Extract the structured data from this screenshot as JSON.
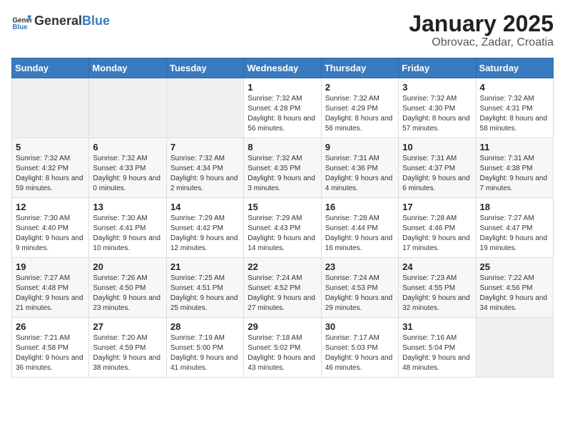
{
  "header": {
    "logo_general": "General",
    "logo_blue": "Blue",
    "title": "January 2025",
    "subtitle": "Obrovac, Zadar, Croatia"
  },
  "calendar": {
    "days_of_week": [
      "Sunday",
      "Monday",
      "Tuesday",
      "Wednesday",
      "Thursday",
      "Friday",
      "Saturday"
    ],
    "weeks": [
      [
        {
          "day": "",
          "info": ""
        },
        {
          "day": "",
          "info": ""
        },
        {
          "day": "",
          "info": ""
        },
        {
          "day": "1",
          "info": "Sunrise: 7:32 AM\nSunset: 4:28 PM\nDaylight: 8 hours and 56 minutes."
        },
        {
          "day": "2",
          "info": "Sunrise: 7:32 AM\nSunset: 4:29 PM\nDaylight: 8 hours and 56 minutes."
        },
        {
          "day": "3",
          "info": "Sunrise: 7:32 AM\nSunset: 4:30 PM\nDaylight: 8 hours and 57 minutes."
        },
        {
          "day": "4",
          "info": "Sunrise: 7:32 AM\nSunset: 4:31 PM\nDaylight: 8 hours and 58 minutes."
        }
      ],
      [
        {
          "day": "5",
          "info": "Sunrise: 7:32 AM\nSunset: 4:32 PM\nDaylight: 8 hours and 59 minutes."
        },
        {
          "day": "6",
          "info": "Sunrise: 7:32 AM\nSunset: 4:33 PM\nDaylight: 9 hours and 0 minutes."
        },
        {
          "day": "7",
          "info": "Sunrise: 7:32 AM\nSunset: 4:34 PM\nDaylight: 9 hours and 2 minutes."
        },
        {
          "day": "8",
          "info": "Sunrise: 7:32 AM\nSunset: 4:35 PM\nDaylight: 9 hours and 3 minutes."
        },
        {
          "day": "9",
          "info": "Sunrise: 7:31 AM\nSunset: 4:36 PM\nDaylight: 9 hours and 4 minutes."
        },
        {
          "day": "10",
          "info": "Sunrise: 7:31 AM\nSunset: 4:37 PM\nDaylight: 9 hours and 6 minutes."
        },
        {
          "day": "11",
          "info": "Sunrise: 7:31 AM\nSunset: 4:38 PM\nDaylight: 9 hours and 7 minutes."
        }
      ],
      [
        {
          "day": "12",
          "info": "Sunrise: 7:30 AM\nSunset: 4:40 PM\nDaylight: 9 hours and 9 minutes."
        },
        {
          "day": "13",
          "info": "Sunrise: 7:30 AM\nSunset: 4:41 PM\nDaylight: 9 hours and 10 minutes."
        },
        {
          "day": "14",
          "info": "Sunrise: 7:29 AM\nSunset: 4:42 PM\nDaylight: 9 hours and 12 minutes."
        },
        {
          "day": "15",
          "info": "Sunrise: 7:29 AM\nSunset: 4:43 PM\nDaylight: 9 hours and 14 minutes."
        },
        {
          "day": "16",
          "info": "Sunrise: 7:28 AM\nSunset: 4:44 PM\nDaylight: 9 hours and 16 minutes."
        },
        {
          "day": "17",
          "info": "Sunrise: 7:28 AM\nSunset: 4:46 PM\nDaylight: 9 hours and 17 minutes."
        },
        {
          "day": "18",
          "info": "Sunrise: 7:27 AM\nSunset: 4:47 PM\nDaylight: 9 hours and 19 minutes."
        }
      ],
      [
        {
          "day": "19",
          "info": "Sunrise: 7:27 AM\nSunset: 4:48 PM\nDaylight: 9 hours and 21 minutes."
        },
        {
          "day": "20",
          "info": "Sunrise: 7:26 AM\nSunset: 4:50 PM\nDaylight: 9 hours and 23 minutes."
        },
        {
          "day": "21",
          "info": "Sunrise: 7:25 AM\nSunset: 4:51 PM\nDaylight: 9 hours and 25 minutes."
        },
        {
          "day": "22",
          "info": "Sunrise: 7:24 AM\nSunset: 4:52 PM\nDaylight: 9 hours and 27 minutes."
        },
        {
          "day": "23",
          "info": "Sunrise: 7:24 AM\nSunset: 4:53 PM\nDaylight: 9 hours and 29 minutes."
        },
        {
          "day": "24",
          "info": "Sunrise: 7:23 AM\nSunset: 4:55 PM\nDaylight: 9 hours and 32 minutes."
        },
        {
          "day": "25",
          "info": "Sunrise: 7:22 AM\nSunset: 4:56 PM\nDaylight: 9 hours and 34 minutes."
        }
      ],
      [
        {
          "day": "26",
          "info": "Sunrise: 7:21 AM\nSunset: 4:58 PM\nDaylight: 9 hours and 36 minutes."
        },
        {
          "day": "27",
          "info": "Sunrise: 7:20 AM\nSunset: 4:59 PM\nDaylight: 9 hours and 38 minutes."
        },
        {
          "day": "28",
          "info": "Sunrise: 7:19 AM\nSunset: 5:00 PM\nDaylight: 9 hours and 41 minutes."
        },
        {
          "day": "29",
          "info": "Sunrise: 7:18 AM\nSunset: 5:02 PM\nDaylight: 9 hours and 43 minutes."
        },
        {
          "day": "30",
          "info": "Sunrise: 7:17 AM\nSunset: 5:03 PM\nDaylight: 9 hours and 46 minutes."
        },
        {
          "day": "31",
          "info": "Sunrise: 7:16 AM\nSunset: 5:04 PM\nDaylight: 9 hours and 48 minutes."
        },
        {
          "day": "",
          "info": ""
        }
      ]
    ]
  }
}
